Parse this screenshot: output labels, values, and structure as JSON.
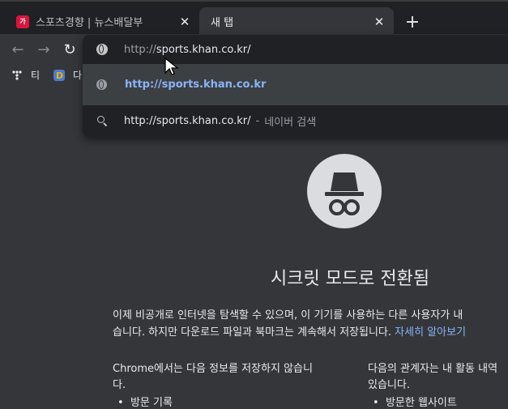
{
  "tabs": [
    {
      "title": "스포츠경향 | 뉴스배달부",
      "favicon_text": "가"
    },
    {
      "title": "새 탭"
    }
  ],
  "bookmarks": [
    {
      "label": "티"
    },
    {
      "label": "다"
    }
  ],
  "omnibox": {
    "scheme": "http://",
    "host_path": "sports.khan.co.kr/"
  },
  "suggestions": {
    "first": "http://sports.khan.co.kr",
    "second_url": "http://sports.khan.co.kr/",
    "second_separator": "-",
    "second_engine": "네이버 검색"
  },
  "incognito": {
    "headline": "시크릿 모드로 전환됨",
    "para_line1": "이제 비공개로 인터넷을 탐색할 수 있으며, 이 기기를 사용하는 다른 사용자가 내",
    "para_line2": "습니다. 하지만 다운로드 파일과 북마크는 계속해서 저장됩니다.",
    "learn_more": "자세히 알아보기",
    "left_heading_line1": "Chrome에서는 다음 정보를 저장하지 않습니",
    "left_heading_line2": "다.",
    "left_bullet": "방문 기록",
    "right_heading_line1": "다음의 관계자는 내 활동 내역",
    "right_heading_line2": "있습니다.",
    "right_bullet": "방문한 웹사이트"
  },
  "colors": {
    "tabstrip": "#202124",
    "toolbar": "#35363a",
    "link": "#8ab4f8",
    "favicon": "#d8163d"
  }
}
